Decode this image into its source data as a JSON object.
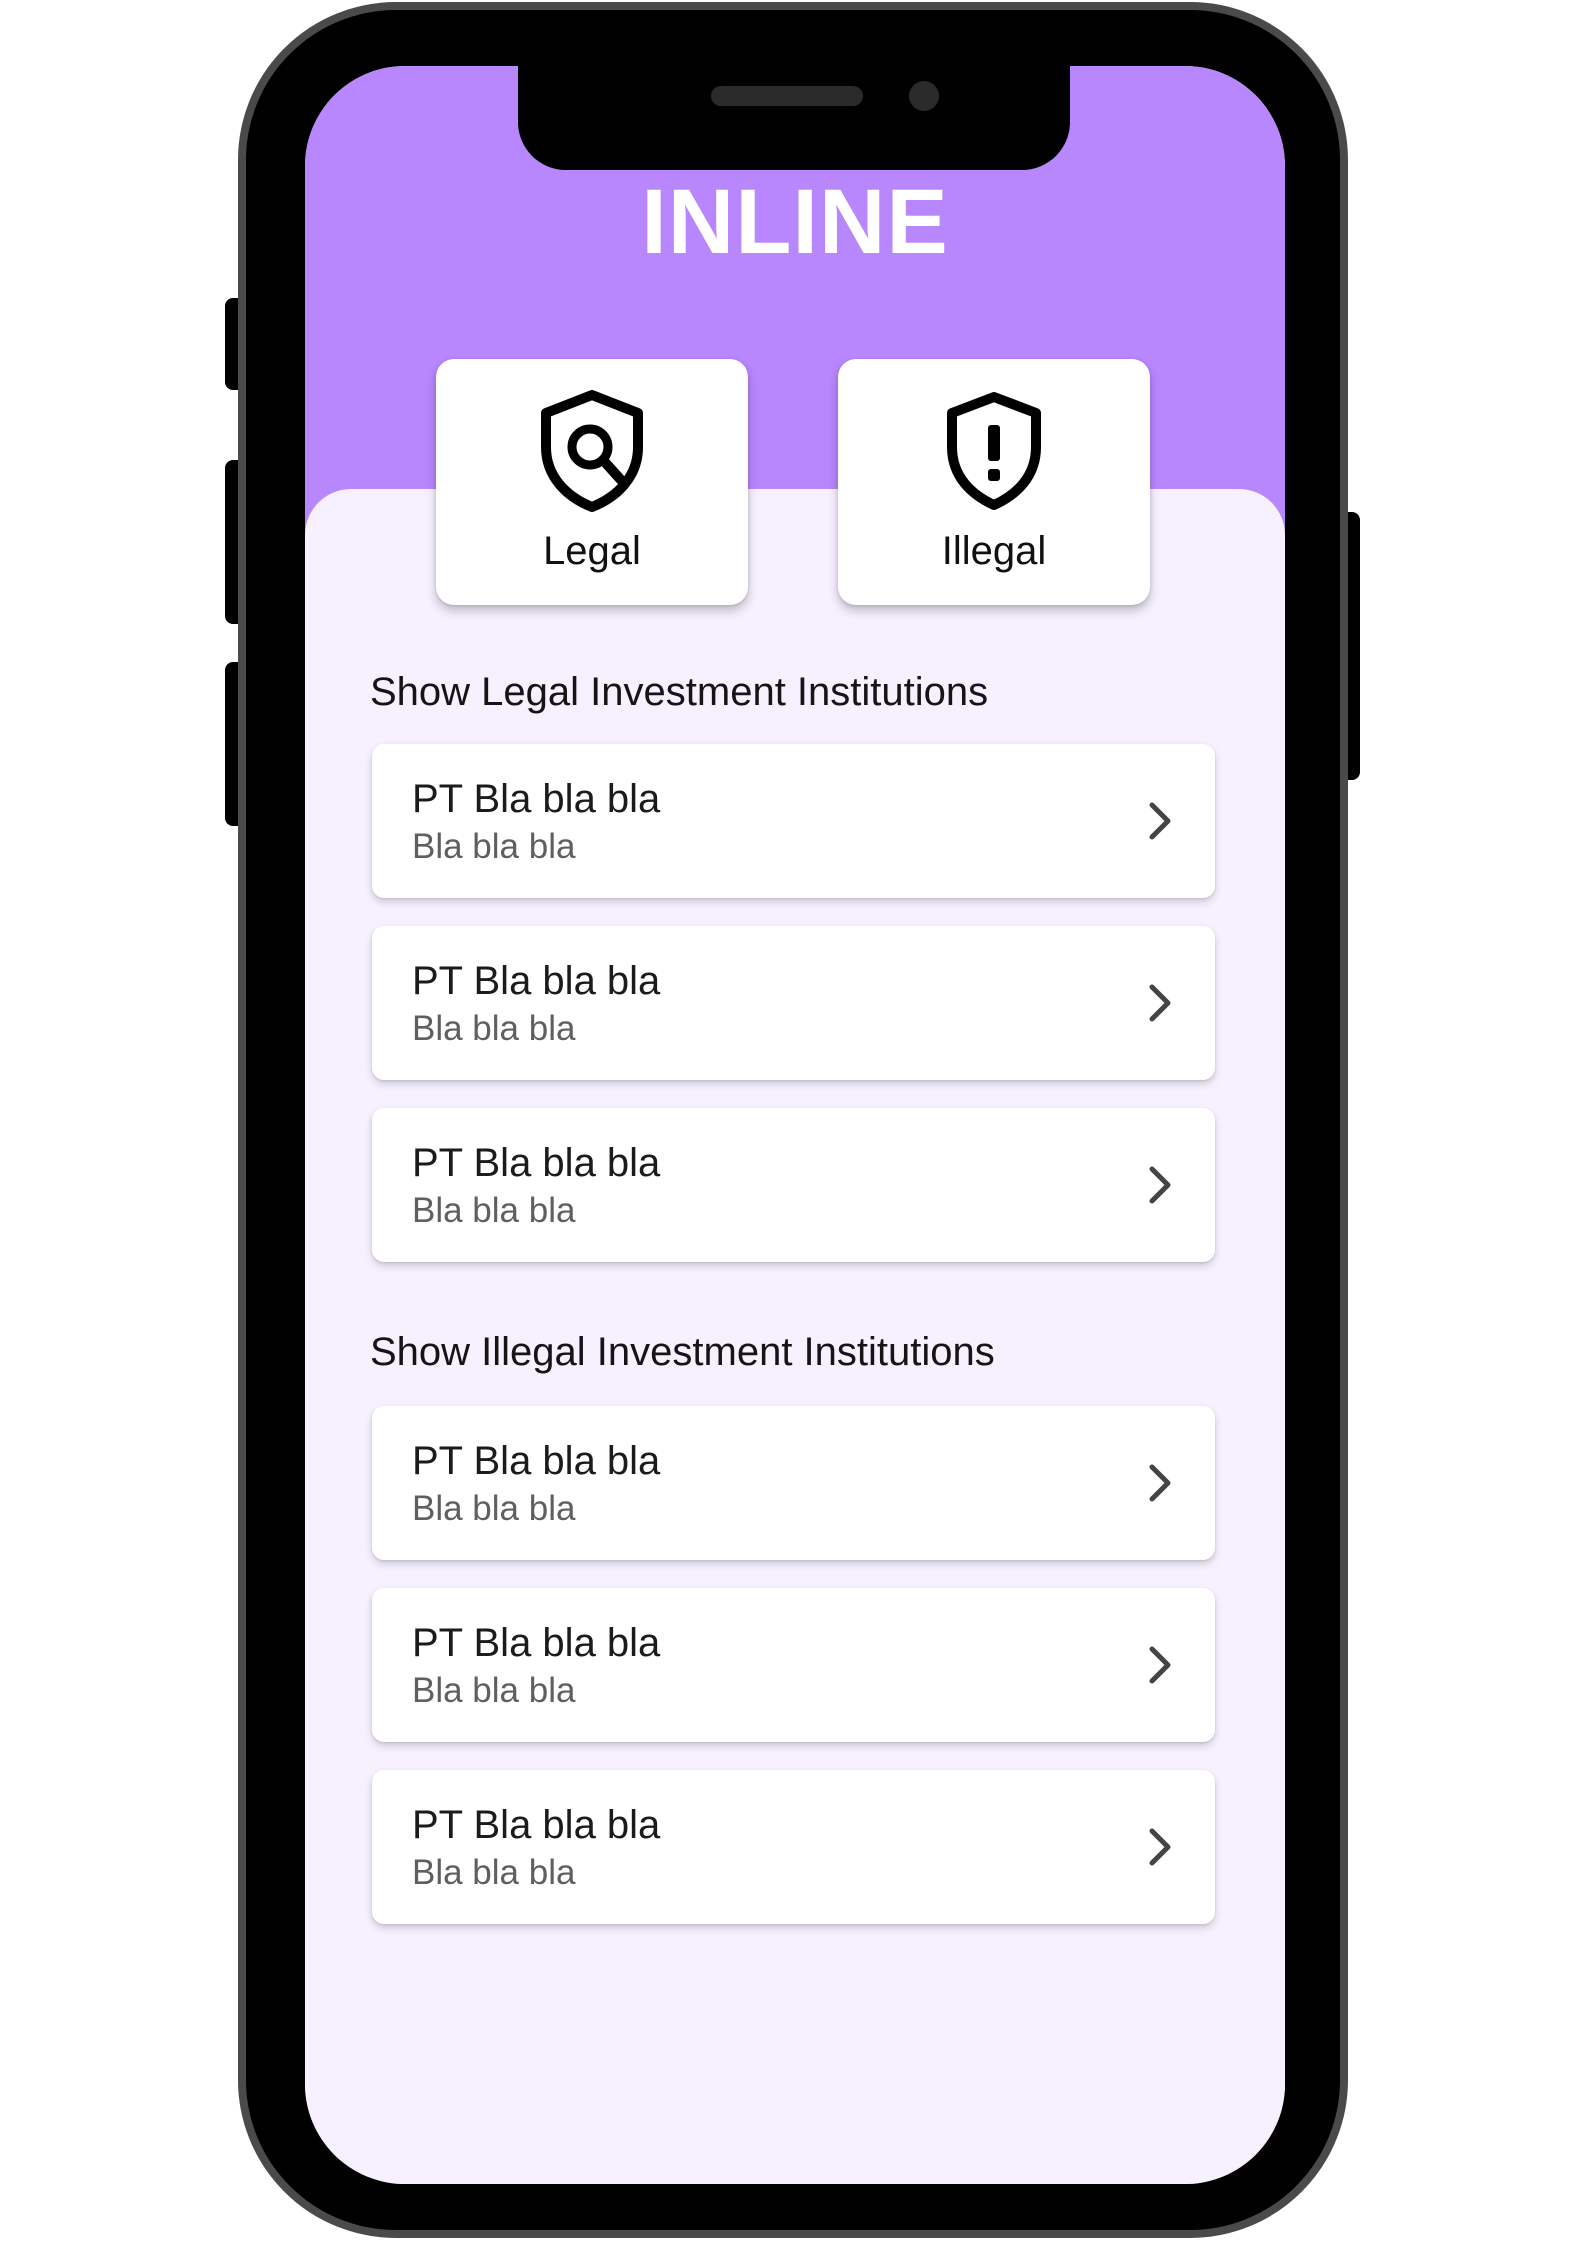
{
  "app": {
    "title": "INLINE",
    "accent_color": "#b886fd",
    "background_color": "#f6f0ff"
  },
  "categories": [
    {
      "label": "Legal",
      "icon": "shield-search-icon"
    },
    {
      "label": "Illegal",
      "icon": "shield-alert-icon"
    }
  ],
  "sections": [
    {
      "title": "Show Legal Investment Institutions",
      "items": [
        {
          "name": "PT Bla bla bla",
          "subtitle": "Bla bla bla"
        },
        {
          "name": "PT Bla bla bla",
          "subtitle": "Bla bla bla"
        },
        {
          "name": "PT Bla bla bla",
          "subtitle": "Bla bla bla"
        }
      ]
    },
    {
      "title": "Show Illegal Investment Institutions",
      "items": [
        {
          "name": "PT Bla bla bla",
          "subtitle": "Bla bla bla"
        },
        {
          "name": "PT Bla bla bla",
          "subtitle": "Bla bla bla"
        },
        {
          "name": "PT Bla bla bla",
          "subtitle": "Bla bla bla"
        }
      ]
    }
  ]
}
